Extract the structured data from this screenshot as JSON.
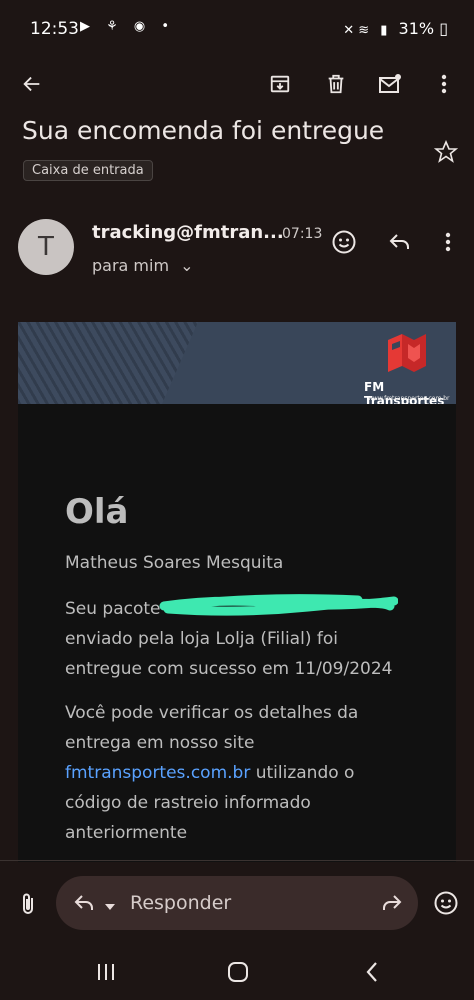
{
  "status": {
    "time": "12:53",
    "battery": "31%",
    "network": "LTE1"
  },
  "toolbar": {
    "back": "back",
    "archive": "archive",
    "delete": "delete",
    "mark_unread": "mark unread",
    "more": "more"
  },
  "email": {
    "subject": "Sua encomenda foi entregue",
    "label": "Caixa de entrada",
    "avatar_letter": "T",
    "sender": "tracking@fmtran...",
    "time": "07:13",
    "to": "para mim"
  },
  "banner": {
    "brand": "FM Transportes",
    "url": "www.fmtransportes.com.br"
  },
  "body": {
    "greeting": "Olá",
    "name": "Matheus Soares Mesquita",
    "line1": "Seu pacote",
    "line2": "enviado pela loja Lolja (Filial) foi",
    "line3": "entregue com sucesso em 11/09/2024",
    "p2_line1": "Você pode verificar os detalhes da",
    "p2_line2": "entrega em nosso site",
    "link": "fmtransportes.com.br",
    "p2_line3_rest": " utilizando o",
    "p2_line4": "código de rastreio informado",
    "p2_line5": "anteriormente"
  },
  "reply": {
    "placeholder": "Responder"
  },
  "colors": {
    "accent_link": "#5aa2ff",
    "brand_red": "#e53935",
    "background": "#1d1514"
  }
}
